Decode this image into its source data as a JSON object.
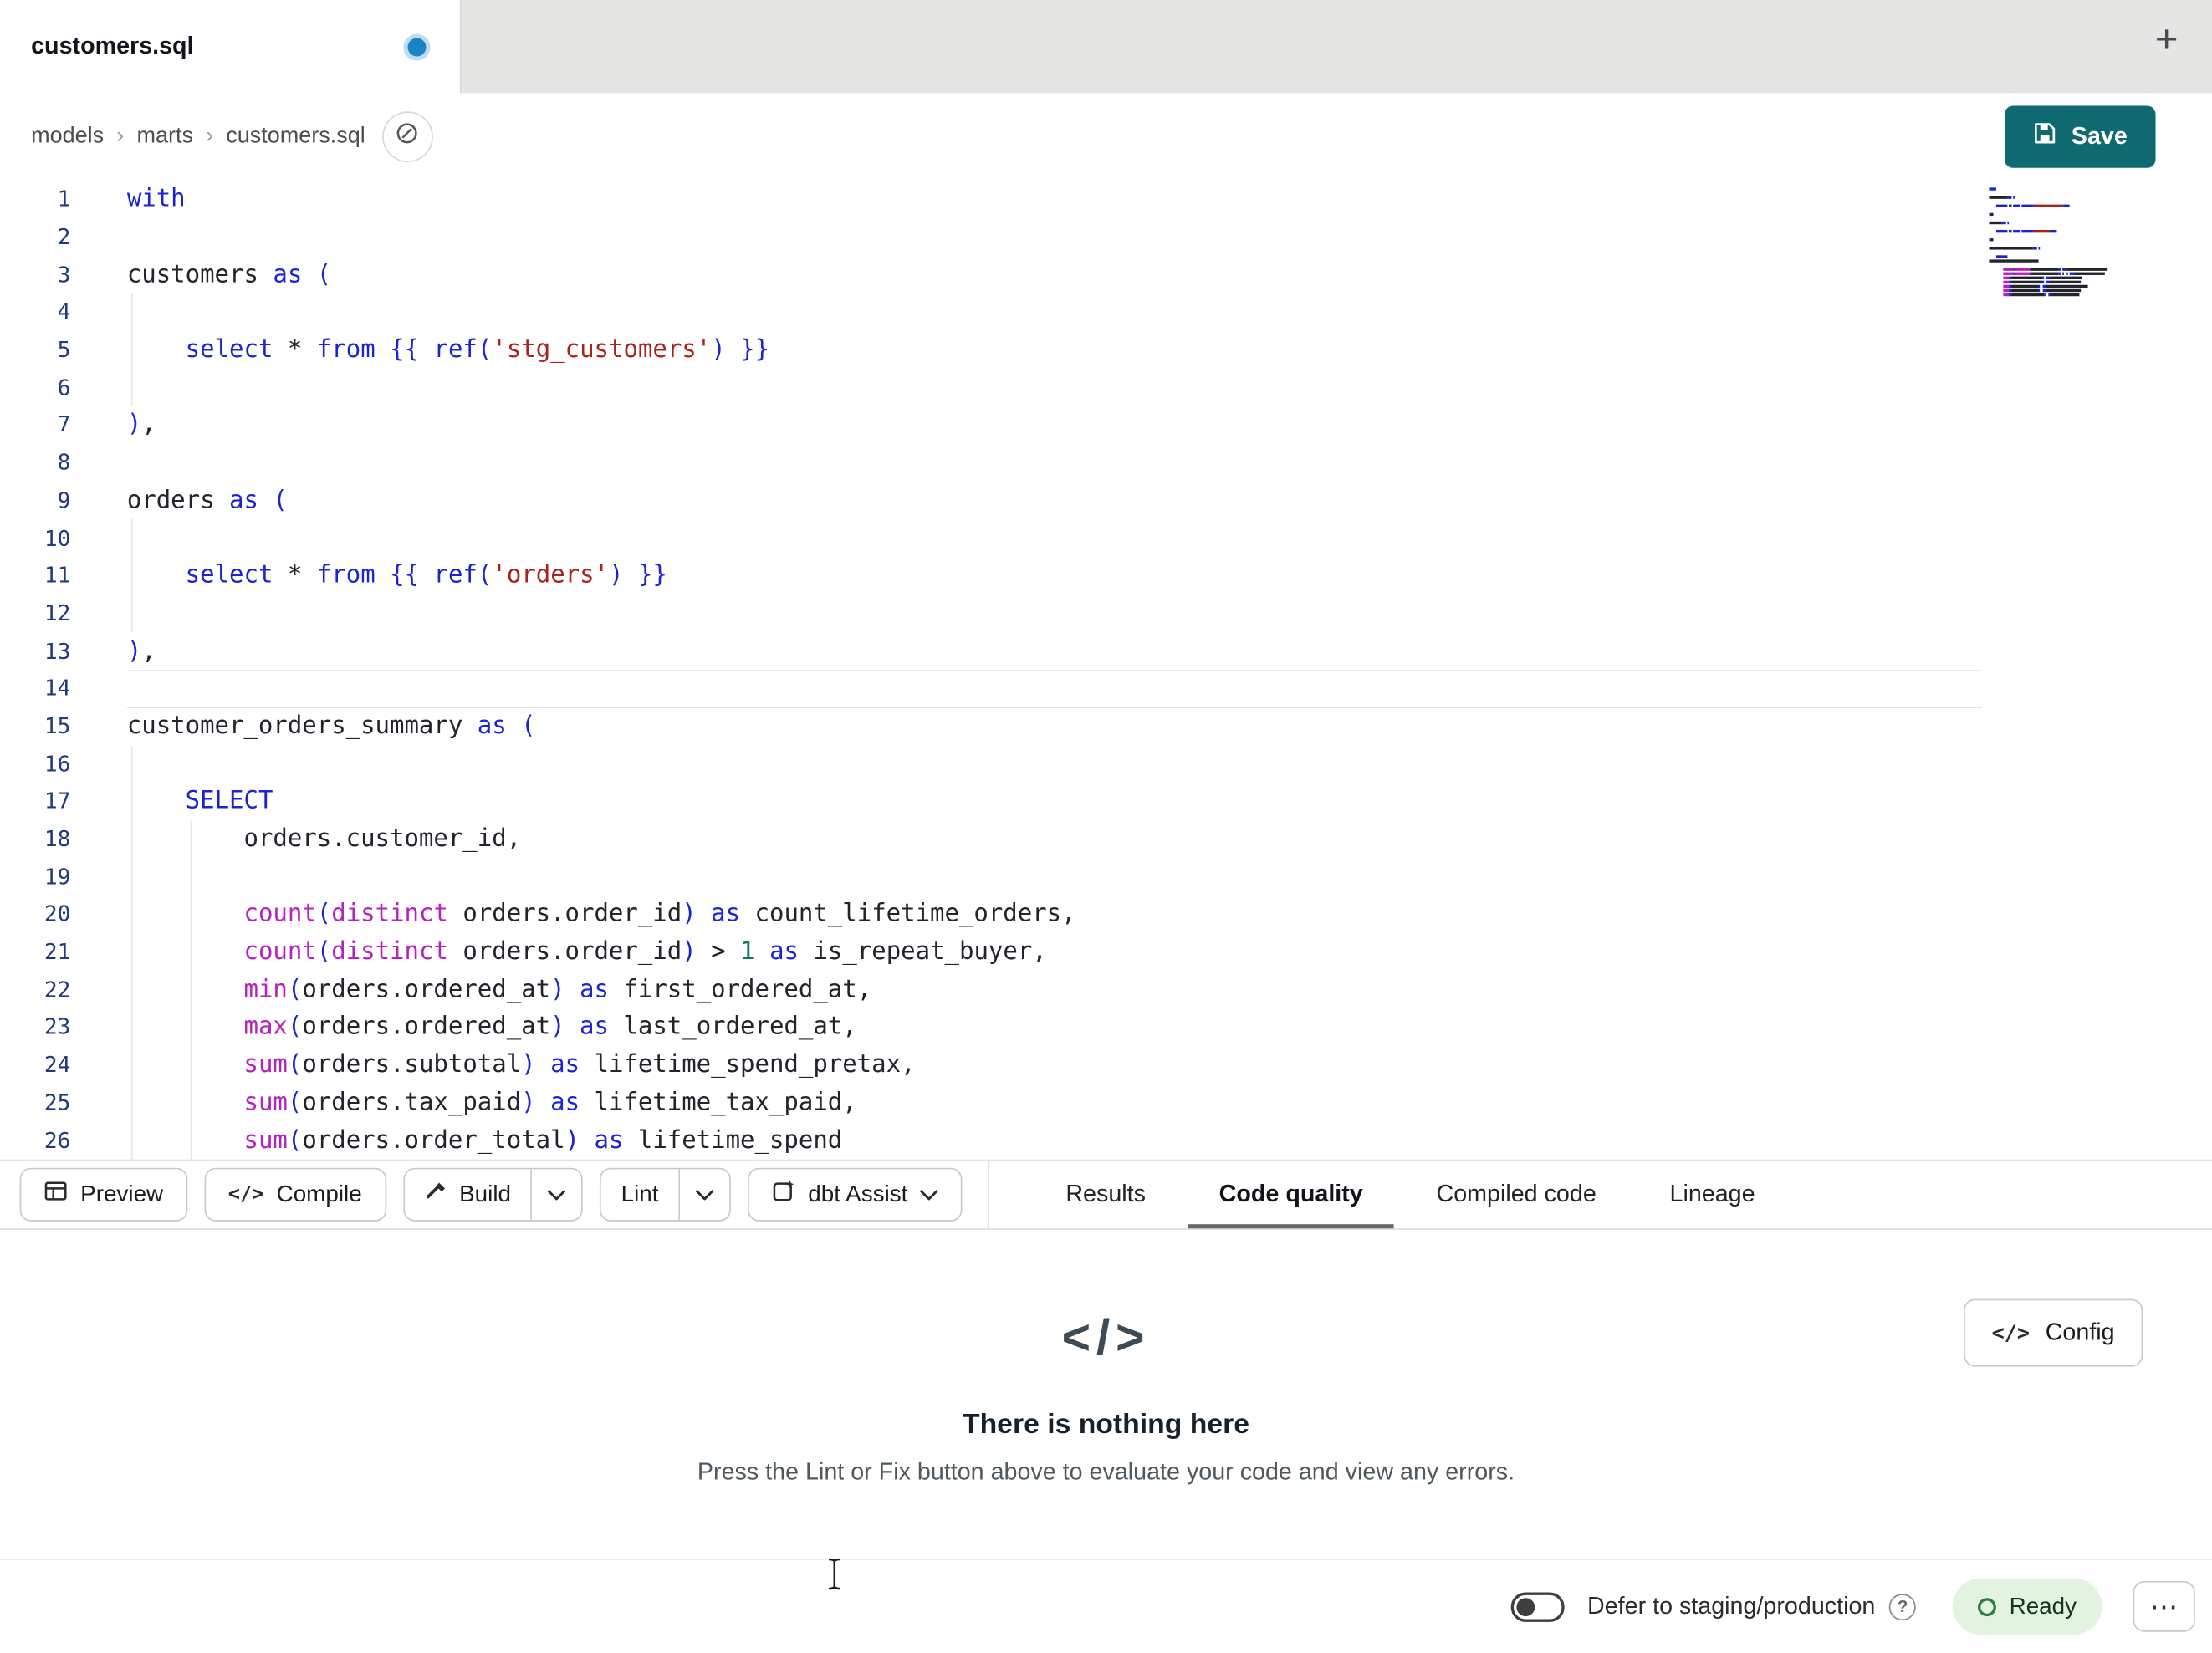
{
  "window": {
    "tab_title": "customers.sql"
  },
  "tab_bar": {
    "new_tab_label": "+"
  },
  "breadcrumb": {
    "items": [
      "models",
      "marts",
      "customers.sql"
    ],
    "separator": "›"
  },
  "actions": {
    "save_label": "Save"
  },
  "icons": {
    "code": "</>"
  },
  "editor": {
    "current_line": 14,
    "colors": {
      "kw": "#1d24cf",
      "fn": "#b622bc",
      "str": "#a82320",
      "num": "#0c7a4b",
      "plain": "#21252b",
      "op": "#21252b",
      "punct": "#1d24cf"
    },
    "indent_guides": [
      {
        "col": 0,
        "s": 4,
        "e": 6
      },
      {
        "col": 0,
        "s": 10,
        "e": 12
      },
      {
        "col": 0,
        "s": 16,
        "e": 26
      },
      {
        "col": 1,
        "s": 18,
        "e": 26
      }
    ],
    "lines": [
      {
        "tokens": [
          [
            "kw",
            "with"
          ]
        ]
      },
      {
        "tokens": []
      },
      {
        "tokens": [
          [
            "plain",
            "customers "
          ],
          [
            "kw",
            "as"
          ],
          [
            "plain",
            " "
          ],
          [
            "punct",
            "("
          ]
        ]
      },
      {
        "tokens": []
      },
      {
        "tokens": [
          [
            "plain",
            "    "
          ],
          [
            "kw",
            "select"
          ],
          [
            "plain",
            " "
          ],
          [
            "op",
            "*"
          ],
          [
            "plain",
            " "
          ],
          [
            "kw",
            "from"
          ],
          [
            "plain",
            " "
          ],
          [
            "punct",
            "{{ "
          ],
          [
            "kw",
            "ref"
          ],
          [
            "punct",
            "("
          ],
          [
            "str",
            "'stg_customers'"
          ],
          [
            "punct",
            ")"
          ],
          [
            "punct",
            " }}"
          ]
        ]
      },
      {
        "tokens": []
      },
      {
        "tokens": [
          [
            "punct",
            ")"
          ],
          [
            "plain",
            ","
          ]
        ]
      },
      {
        "tokens": []
      },
      {
        "tokens": [
          [
            "plain",
            "orders "
          ],
          [
            "kw",
            "as"
          ],
          [
            "plain",
            " "
          ],
          [
            "punct",
            "("
          ]
        ]
      },
      {
        "tokens": []
      },
      {
        "tokens": [
          [
            "plain",
            "    "
          ],
          [
            "kw",
            "select"
          ],
          [
            "plain",
            " "
          ],
          [
            "op",
            "*"
          ],
          [
            "plain",
            " "
          ],
          [
            "kw",
            "from"
          ],
          [
            "plain",
            " "
          ],
          [
            "punct",
            "{{ "
          ],
          [
            "kw",
            "ref"
          ],
          [
            "punct",
            "("
          ],
          [
            "str",
            "'orders'"
          ],
          [
            "punct",
            ")"
          ],
          [
            "punct",
            " }}"
          ]
        ]
      },
      {
        "tokens": []
      },
      {
        "tokens": [
          [
            "punct",
            ")"
          ],
          [
            "plain",
            ","
          ]
        ]
      },
      {
        "tokens": []
      },
      {
        "tokens": [
          [
            "plain",
            "customer_orders_summary "
          ],
          [
            "kw",
            "as"
          ],
          [
            "plain",
            " "
          ],
          [
            "punct",
            "("
          ]
        ]
      },
      {
        "tokens": []
      },
      {
        "tokens": [
          [
            "plain",
            "    "
          ],
          [
            "kw",
            "SELECT"
          ]
        ]
      },
      {
        "tokens": [
          [
            "plain",
            "        orders.customer_id,"
          ]
        ]
      },
      {
        "tokens": []
      },
      {
        "tokens": [
          [
            "plain",
            "        "
          ],
          [
            "fn",
            "count"
          ],
          [
            "punct",
            "("
          ],
          [
            "fn",
            "distinct"
          ],
          [
            "plain",
            " orders.order_id"
          ],
          [
            "punct",
            ")"
          ],
          [
            "plain",
            " "
          ],
          [
            "kw",
            "as"
          ],
          [
            "plain",
            " count_lifetime_orders,"
          ]
        ]
      },
      {
        "tokens": [
          [
            "plain",
            "        "
          ],
          [
            "fn",
            "count"
          ],
          [
            "punct",
            "("
          ],
          [
            "fn",
            "distinct"
          ],
          [
            "plain",
            " orders.order_id"
          ],
          [
            "punct",
            ")"
          ],
          [
            "plain",
            " "
          ],
          [
            "op",
            ">"
          ],
          [
            "plain",
            " "
          ],
          [
            "num",
            "1"
          ],
          [
            "plain",
            " "
          ],
          [
            "kw",
            "as"
          ],
          [
            "plain",
            " is_repeat_buyer,"
          ]
        ]
      },
      {
        "tokens": [
          [
            "plain",
            "        "
          ],
          [
            "fn",
            "min"
          ],
          [
            "punct",
            "("
          ],
          [
            "plain",
            "orders.ordered_at"
          ],
          [
            "punct",
            ")"
          ],
          [
            "plain",
            " "
          ],
          [
            "kw",
            "as"
          ],
          [
            "plain",
            " first_ordered_at,"
          ]
        ]
      },
      {
        "tokens": [
          [
            "plain",
            "        "
          ],
          [
            "fn",
            "max"
          ],
          [
            "punct",
            "("
          ],
          [
            "plain",
            "orders.ordered_at"
          ],
          [
            "punct",
            ")"
          ],
          [
            "plain",
            " "
          ],
          [
            "kw",
            "as"
          ],
          [
            "plain",
            " last_ordered_at,"
          ]
        ]
      },
      {
        "tokens": [
          [
            "plain",
            "        "
          ],
          [
            "fn",
            "sum"
          ],
          [
            "punct",
            "("
          ],
          [
            "plain",
            "orders.subtotal"
          ],
          [
            "punct",
            ")"
          ],
          [
            "plain",
            " "
          ],
          [
            "kw",
            "as"
          ],
          [
            "plain",
            " lifetime_spend_pretax,"
          ]
        ]
      },
      {
        "tokens": [
          [
            "plain",
            "        "
          ],
          [
            "fn",
            "sum"
          ],
          [
            "punct",
            "("
          ],
          [
            "plain",
            "orders.tax_paid"
          ],
          [
            "punct",
            ")"
          ],
          [
            "plain",
            " "
          ],
          [
            "kw",
            "as"
          ],
          [
            "plain",
            " lifetime_tax_paid,"
          ]
        ]
      },
      {
        "tokens": [
          [
            "plain",
            "        "
          ],
          [
            "fn",
            "sum"
          ],
          [
            "punct",
            "("
          ],
          [
            "plain",
            "orders.order_total"
          ],
          [
            "punct",
            ")"
          ],
          [
            "plain",
            " "
          ],
          [
            "kw",
            "as"
          ],
          [
            "plain",
            " lifetime_spend"
          ]
        ]
      }
    ]
  },
  "toolbar": {
    "preview": "Preview",
    "compile": "Compile",
    "build": "Build",
    "lint": "Lint",
    "assist": "dbt Assist"
  },
  "panel_tabs": [
    {
      "label": "Results",
      "active": false
    },
    {
      "label": "Code quality",
      "active": true
    },
    {
      "label": "Compiled code",
      "active": false
    },
    {
      "label": "Lineage",
      "active": false
    }
  ],
  "results_panel": {
    "config_label": "Config",
    "empty_icon": "</>",
    "empty_title": "There is nothing here",
    "empty_subtitle": "Press the Lint or Fix button above to evaluate your code and view any errors."
  },
  "footer": {
    "defer_label": "Defer to staging/production",
    "help": "?",
    "status": "Ready",
    "menu": "⋯"
  }
}
